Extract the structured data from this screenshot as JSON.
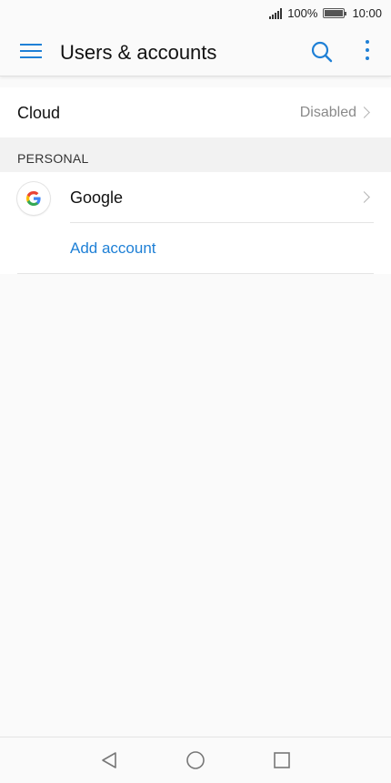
{
  "status_bar": {
    "battery_percent": "100%",
    "battery_level": 1.0,
    "time": "10:00"
  },
  "app_bar": {
    "title": "Users & accounts",
    "menu_icon": "hamburger-menu-icon",
    "search_icon": "search-icon",
    "more_icon": "more-vertical-icon"
  },
  "cloud": {
    "label": "Cloud",
    "status": "Disabled"
  },
  "personal_section": {
    "header": "PERSONAL",
    "accounts": [
      {
        "label": "Google",
        "icon": "google-logo-icon"
      }
    ],
    "add_account_label": "Add account"
  },
  "colors": {
    "accent": "#1f80d6",
    "secondary_text": "#8a8a8a",
    "section_background": "#f2f2f2"
  },
  "nav_bar": {
    "back_icon": "back-triangle-icon",
    "home_icon": "home-circle-icon",
    "recents_icon": "recents-square-icon"
  }
}
